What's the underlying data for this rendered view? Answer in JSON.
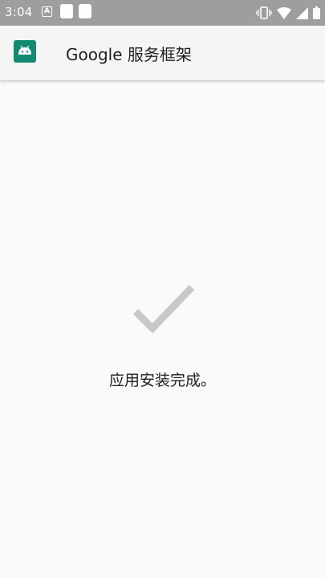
{
  "status_bar": {
    "time": "3:04",
    "notification_letter": "A",
    "icons": [
      "notification-a-icon",
      "notification-square-icon",
      "notification-square-icon",
      "vibrate-icon",
      "wifi-icon",
      "signal-icon",
      "battery-icon"
    ]
  },
  "app_bar": {
    "title": "Google 服务框架",
    "icon": "android-icon"
  },
  "content": {
    "icon": "checkmark-icon",
    "message": "应用安装完成。"
  },
  "colors": {
    "status_bar": "#9e9e9e",
    "app_icon_bg": "#138a72",
    "check": "#c8c8c8",
    "background": "#fafafa"
  }
}
